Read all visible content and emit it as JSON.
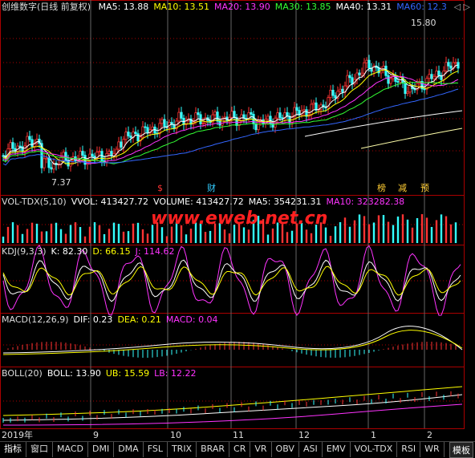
{
  "stock": {
    "name": "创维数字",
    "mode": "(日线 前复权)"
  },
  "ma_line": [
    {
      "label": "MA5: 13.88",
      "color": "#ffffff"
    },
    {
      "label": "MA10: 13.51",
      "color": "#ffff00"
    },
    {
      "label": "MA20: 13.90",
      "color": "#ff33ff"
    },
    {
      "label": "MA30: 13.85",
      "color": "#33ff33"
    },
    {
      "label": "MA40: 13.31",
      "color": "#ffffff"
    },
    {
      "label": "MA60: 12.3",
      "color": "#3366ff"
    }
  ],
  "annotations": {
    "high": "15.80",
    "low": "7.37",
    "mark1": "$",
    "mark2": "财",
    "mark3": "榜",
    "mark4": "减",
    "mark5": "预"
  },
  "vol_line": {
    "name": "VOL-TDX(5,10)",
    "items": [
      {
        "label": "VVOL: 413427.72",
        "color": "#ffffff"
      },
      {
        "label": "VOLUME: 413427.72",
        "color": "#ffffff"
      },
      {
        "label": "MA5: 354231.31",
        "color": "#ffffff"
      },
      {
        "label": "MA10: 323282.38",
        "color": "#ff33ff"
      }
    ]
  },
  "watermark": "www.eweb.net.cn",
  "kdj_line": {
    "name": "KDJ(9,3,3)",
    "items": [
      {
        "label": "K: 82.30",
        "color": "#ffffff"
      },
      {
        "label": "D: 66.15",
        "color": "#ffff00"
      },
      {
        "label": "J: 114.62",
        "color": "#ff33ff"
      }
    ]
  },
  "macd_line": {
    "name": "MACD(12,26,9)",
    "items": [
      {
        "label": "DIF: 0.23",
        "color": "#ffffff"
      },
      {
        "label": "DEA: 0.21",
        "color": "#ffff00"
      },
      {
        "label": "MACD: 0.04",
        "color": "#ff33ff"
      }
    ]
  },
  "boll_line": {
    "name": "BOLL(20)",
    "items": [
      {
        "label": "BOLL: 13.90",
        "color": "#ffffff"
      },
      {
        "label": "UB: 15.59",
        "color": "#ffff00"
      },
      {
        "label": "LB: 12.22",
        "color": "#ff33ff"
      }
    ]
  },
  "time_axis": [
    "2019年",
    "9",
    "10",
    "11",
    "12",
    "1",
    "2"
  ],
  "tabs": [
    "指标",
    "窗口",
    "MACD",
    "DMI",
    "DMA",
    "FSL",
    "TRIX",
    "BRAR",
    "CR",
    "VR",
    "OBV",
    "ASI",
    "EMV",
    "VOL-TDX",
    "RSI",
    "WR"
  ],
  "template_label": "模板",
  "arrows": "◁ ▷"
}
